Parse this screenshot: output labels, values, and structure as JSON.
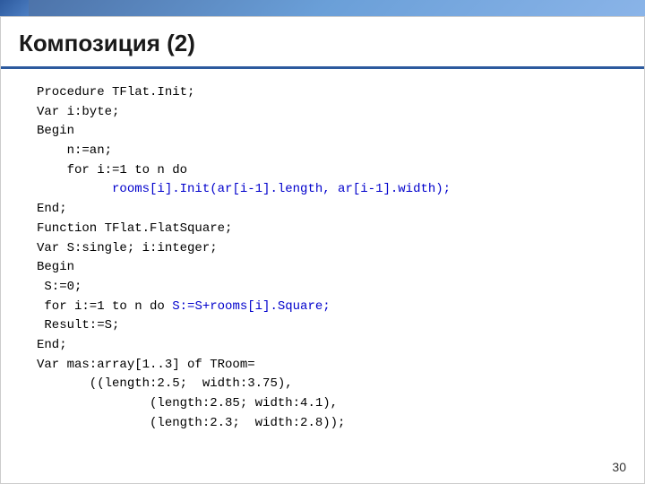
{
  "slide": {
    "title": "Композиция (2)",
    "page_number": "30",
    "code_lines": [
      {
        "id": 1,
        "text": "Procedure TFlat.Init;",
        "highlight": null
      },
      {
        "id": 2,
        "text": "Var i:byte;",
        "highlight": null
      },
      {
        "id": 3,
        "text": "Begin",
        "highlight": null
      },
      {
        "id": 4,
        "text": "   n:=an;",
        "highlight": null
      },
      {
        "id": 5,
        "text": "   for i:=1 to n do",
        "highlight": null
      },
      {
        "id": 6,
        "text": "         rooms[i].Init(ar[i-1].length, ar[i-1].width);",
        "highlight": "blue"
      },
      {
        "id": 7,
        "text": "End;",
        "highlight": null
      },
      {
        "id": 8,
        "text": "Function TFlat.FlatSquare;",
        "highlight": null
      },
      {
        "id": 9,
        "text": "Var S:single; i:integer;",
        "highlight": null
      },
      {
        "id": 10,
        "text": "Begin",
        "highlight": null
      },
      {
        "id": 11,
        "text": " S:=0;",
        "highlight": null
      },
      {
        "id": 12,
        "text": " for i:=1 to n do ",
        "highlight": null
      },
      {
        "id": 12,
        "text_highlight": "S:=S+rooms[i].Square;",
        "highlight": "blue"
      },
      {
        "id": 13,
        "text": " Result:=S;",
        "highlight": null
      },
      {
        "id": 14,
        "text": "End;",
        "highlight": null
      },
      {
        "id": 15,
        "text": "Var mas:array[1..3] of TRoom=",
        "highlight": null
      },
      {
        "id": 16,
        "text": "       ((length:2.5;  width:3.75),",
        "highlight": null
      },
      {
        "id": 17,
        "text": "               (length:2.85; width:4.1),",
        "highlight": null
      },
      {
        "id": 18,
        "text": "               (length:2.3;  width:2.8));",
        "highlight": null
      }
    ]
  }
}
